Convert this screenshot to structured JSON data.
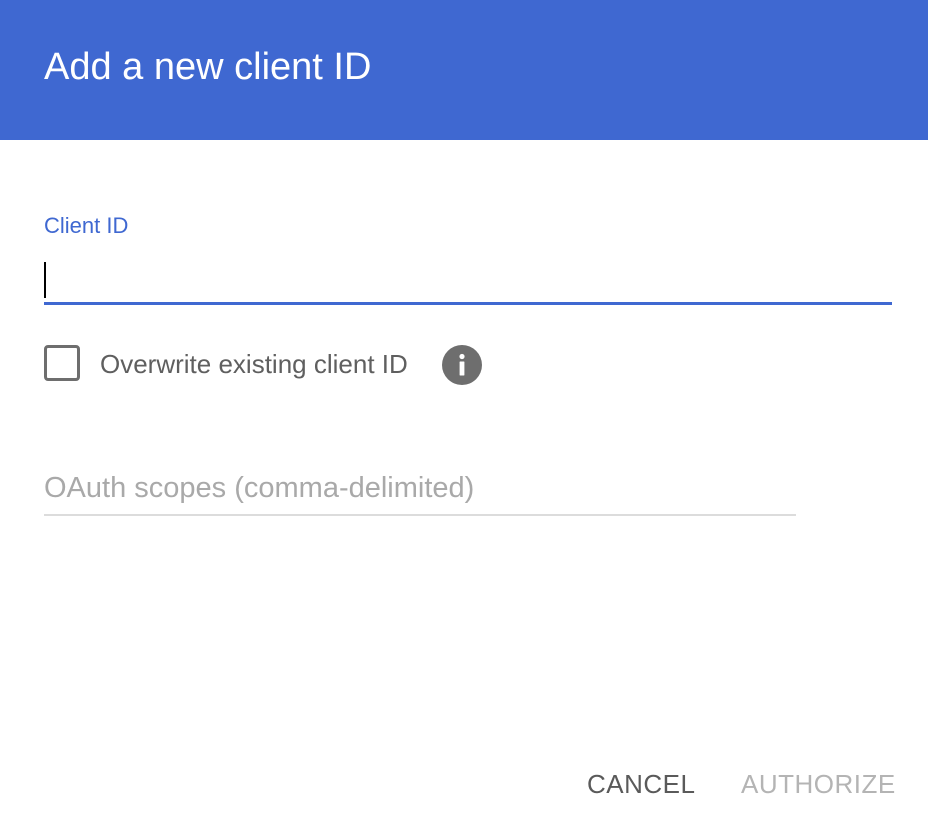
{
  "dialog": {
    "title": "Add a new client ID"
  },
  "client_id": {
    "label": "Client ID",
    "value": ""
  },
  "overwrite": {
    "label": "Overwrite existing client ID",
    "checked": false,
    "info_icon": "info-icon"
  },
  "scopes": {
    "placeholder": "OAuth scopes (comma-delimited)",
    "value": ""
  },
  "actions": {
    "cancel_label": "CANCEL",
    "authorize_label": "AUTHORIZE"
  },
  "colors": {
    "accent": "#3f68d1",
    "header_text": "#ffffff",
    "disabled": "#b4b4b4"
  }
}
